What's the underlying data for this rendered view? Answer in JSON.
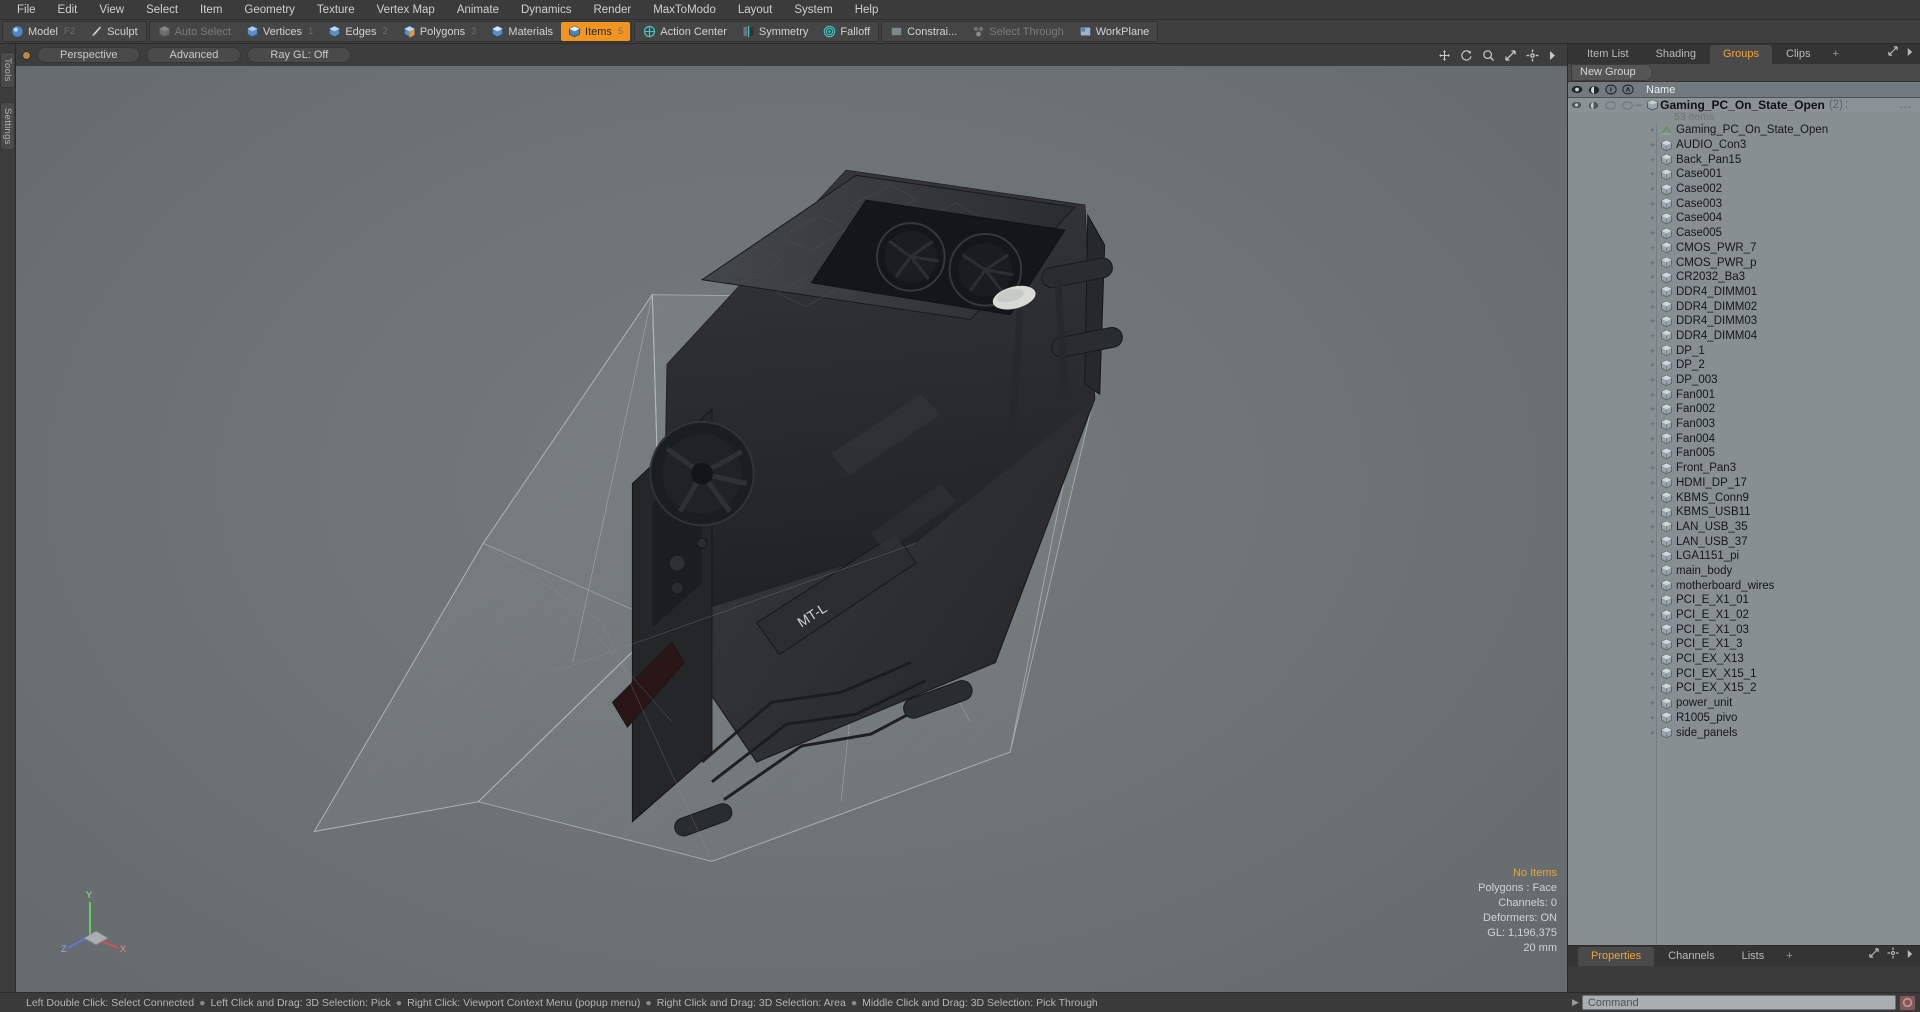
{
  "menu": {
    "items": [
      "File",
      "Edit",
      "View",
      "Select",
      "Item",
      "Geometry",
      "Texture",
      "Vertex Map",
      "Animate",
      "Dynamics",
      "Render",
      "MaxToModo",
      "Layout",
      "System",
      "Help"
    ]
  },
  "toolbar": {
    "mode_group": [
      {
        "label": "Model",
        "icon": "sphere-icon",
        "state": "normal",
        "shortcut": "F2"
      },
      {
        "label": "Sculpt",
        "icon": "brush-icon",
        "state": "normal",
        "shortcut": ""
      }
    ],
    "selection_group": [
      {
        "label": "Auto Select",
        "icon": "auto-select-icon",
        "state": "dim",
        "shortcut": ""
      },
      {
        "label": "Vertices",
        "icon": "vertices-icon",
        "state": "normal",
        "shortcut": "1"
      },
      {
        "label": "Edges",
        "icon": "edges-icon",
        "state": "normal",
        "shortcut": "2"
      },
      {
        "label": "Polygons",
        "icon": "polygons-icon",
        "state": "normal",
        "shortcut": "3"
      },
      {
        "label": "Materials",
        "icon": "materials-icon",
        "state": "normal",
        "shortcut": ""
      },
      {
        "label": "Items",
        "icon": "items-icon",
        "state": "active",
        "shortcut": "5"
      }
    ],
    "modifier_group": [
      {
        "label": "Action Center",
        "icon": "action-center-icon",
        "state": "normal"
      },
      {
        "label": "Symmetry",
        "icon": "symmetry-icon",
        "state": "normal"
      },
      {
        "label": "Falloff",
        "icon": "falloff-icon",
        "state": "normal"
      }
    ],
    "constraint_group": [
      {
        "label": "Constrai...",
        "icon": "constraint-icon",
        "state": "normal"
      },
      {
        "label": "Select Through",
        "icon": "select-through-icon",
        "state": "dim"
      },
      {
        "label": "WorkPlane",
        "icon": "workplane-icon",
        "state": "normal"
      }
    ]
  },
  "left_rail": {
    "tabs": [
      "Tools",
      "Settings"
    ]
  },
  "viewport": {
    "header": {
      "view_mode": "Perspective",
      "shading": "Advanced",
      "raygl": "Ray GL: Off",
      "icons": [
        "move-icon",
        "rotate-icon",
        "zoom-icon",
        "expand-icon",
        "gear-icon",
        "play-icon"
      ]
    },
    "stats": {
      "selection": "No Items",
      "polygons": "Polygons : Face",
      "channels": "Channels: 0",
      "deformers": "Deformers: ON",
      "gl": "GL: 1,196,375",
      "scale": "20 mm"
    },
    "axis_labels": [
      "X",
      "Y",
      "Z"
    ],
    "background_color": "#6f7577"
  },
  "right_panel": {
    "tabs": [
      {
        "label": "Item List",
        "selected": false
      },
      {
        "label": "Shading",
        "selected": false
      },
      {
        "label": "Groups",
        "selected": true
      },
      {
        "label": "Clips",
        "selected": false
      },
      {
        "label": "+",
        "selected": false
      }
    ],
    "new_group_button": "New Group",
    "list_header": {
      "columns": [
        "eye-icon",
        "render-icon",
        "lock-icon",
        "select-icon"
      ],
      "name": "Name"
    },
    "group": {
      "name": "Gaming_PC_On_State_Open",
      "count": "(2)",
      "colon": ":",
      "dots": "...",
      "sub_count": "53 Items"
    },
    "items": [
      {
        "label": "Gaming_PC_On_State_Open",
        "icon": "locator-icon"
      },
      {
        "label": "AUDIO_Con3",
        "icon": "mesh-icon"
      },
      {
        "label": "Back_Pan15",
        "icon": "mesh-icon"
      },
      {
        "label": "Case001",
        "icon": "mesh-icon"
      },
      {
        "label": "Case002",
        "icon": "mesh-icon"
      },
      {
        "label": "Case003",
        "icon": "mesh-icon"
      },
      {
        "label": "Case004",
        "icon": "mesh-icon"
      },
      {
        "label": "Case005",
        "icon": "mesh-icon"
      },
      {
        "label": "CMOS_PWR_7",
        "icon": "mesh-icon"
      },
      {
        "label": "CMOS_PWR_p",
        "icon": "mesh-icon"
      },
      {
        "label": "CR2032_Ba3",
        "icon": "mesh-icon"
      },
      {
        "label": "DDR4_DIMM01",
        "icon": "mesh-icon"
      },
      {
        "label": "DDR4_DIMM02",
        "icon": "mesh-icon"
      },
      {
        "label": "DDR4_DIMM03",
        "icon": "mesh-icon"
      },
      {
        "label": "DDR4_DIMM04",
        "icon": "mesh-icon"
      },
      {
        "label": "DP_1",
        "icon": "mesh-icon"
      },
      {
        "label": "DP_2",
        "icon": "mesh-icon"
      },
      {
        "label": "DP_003",
        "icon": "mesh-icon"
      },
      {
        "label": "Fan001",
        "icon": "mesh-icon"
      },
      {
        "label": "Fan002",
        "icon": "mesh-icon"
      },
      {
        "label": "Fan003",
        "icon": "mesh-icon"
      },
      {
        "label": "Fan004",
        "icon": "mesh-icon"
      },
      {
        "label": "Fan005",
        "icon": "mesh-icon"
      },
      {
        "label": "Front_Pan3",
        "icon": "mesh-icon"
      },
      {
        "label": "HDMI_DP_17",
        "icon": "mesh-icon"
      },
      {
        "label": "KBMS_Conn9",
        "icon": "mesh-icon"
      },
      {
        "label": "KBMS_USB11",
        "icon": "mesh-icon"
      },
      {
        "label": "LAN_USB_35",
        "icon": "mesh-icon"
      },
      {
        "label": "LAN_USB_37",
        "icon": "mesh-icon"
      },
      {
        "label": "LGA1151_pi",
        "icon": "mesh-icon"
      },
      {
        "label": "main_body",
        "icon": "mesh-icon"
      },
      {
        "label": "motherboard_wires",
        "icon": "mesh-icon"
      },
      {
        "label": "PCI_E_X1_01",
        "icon": "mesh-icon"
      },
      {
        "label": "PCI_E_X1_02",
        "icon": "mesh-icon"
      },
      {
        "label": "PCI_E_X1_03",
        "icon": "mesh-icon"
      },
      {
        "label": "PCI_E_X1_3",
        "icon": "mesh-icon"
      },
      {
        "label": "PCI_EX_X13",
        "icon": "mesh-icon"
      },
      {
        "label": "PCI_EX_X15_1",
        "icon": "mesh-icon"
      },
      {
        "label": "PCI_EX_X15_2",
        "icon": "mesh-icon"
      },
      {
        "label": "power_unit",
        "icon": "mesh-icon"
      },
      {
        "label": "R1005_pivo",
        "icon": "mesh-icon"
      },
      {
        "label": "side_panels",
        "icon": "mesh-icon"
      }
    ],
    "bottom_tabs": [
      {
        "label": "Properties",
        "selected": true
      },
      {
        "label": "Channels",
        "selected": false
      },
      {
        "label": "Lists",
        "selected": false
      },
      {
        "label": "+",
        "selected": false
      }
    ]
  },
  "statusbar": {
    "hints": [
      "Left Double Click: Select Connected",
      "Left Click and Drag: 3D Selection: Pick",
      "Right Click: Viewport Context Menu (popup menu)",
      "Right Click and Drag: 3D Selection: Area",
      "Middle Click and Drag: 3D Selection: Pick Through"
    ],
    "command_placeholder": "Command"
  },
  "colors": {
    "accent": "#f29420",
    "panel_bg": "#3b3b3b",
    "list_bg": "#878f93",
    "viewport_bg": "#6f7577"
  }
}
